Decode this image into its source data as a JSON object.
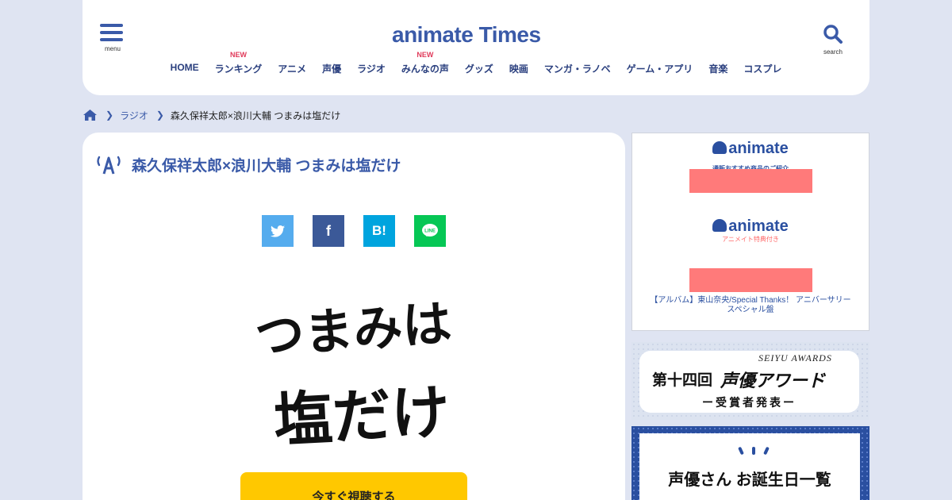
{
  "header": {
    "menu_label": "menu",
    "logo_text": "animate Times",
    "search_label": "search",
    "nav": [
      {
        "label": "HOME",
        "badge": ""
      },
      {
        "label": "ランキング",
        "badge": "NEW"
      },
      {
        "label": "アニメ",
        "badge": ""
      },
      {
        "label": "声優",
        "badge": ""
      },
      {
        "label": "ラジオ",
        "badge": ""
      },
      {
        "label": "みんなの声",
        "badge": "NEW"
      },
      {
        "label": "グッズ",
        "badge": ""
      },
      {
        "label": "映画",
        "badge": ""
      },
      {
        "label": "マンガ・ラノベ",
        "badge": ""
      },
      {
        "label": "ゲーム・アプリ",
        "badge": ""
      },
      {
        "label": "音楽",
        "badge": ""
      },
      {
        "label": "コスプレ",
        "badge": ""
      }
    ]
  },
  "breadcrumb": {
    "category": "ラジオ",
    "current": "森久保祥太郎×浪川大輔 つまみは塩だけ"
  },
  "article": {
    "title": "森久保祥太郎×浪川大輔 つまみは塩だけ",
    "share": {
      "twitter_icon": "twitter-icon",
      "facebook": "f",
      "hatena": "B!",
      "line_icon": "line-icon"
    },
    "key_visual_line1": "つまみは",
    "key_visual_line2": "塩だけ",
    "watch_button": "今すぐ視聴する"
  },
  "sidebar": {
    "ad": {
      "logo_text": "animate",
      "sub1": "通販おすすめ商品のご紹介",
      "sub2": "アニメイト特典付き",
      "caption": "【アルバム】東山奈央/Special Thanks！ アニバーサリースペシャル盤"
    },
    "awards": {
      "prefix": "第十四回",
      "main": "声優アワード",
      "en": "SEIYU AWARDS",
      "sub": "ー受賞者発表ー"
    },
    "birthday": {
      "text": "声優さん お誕生日一覧"
    }
  },
  "colors": {
    "brand": "#3a5aa8",
    "background": "#dfe4f2",
    "cta": "#ffc800",
    "new_badge": "#e03a5a"
  }
}
